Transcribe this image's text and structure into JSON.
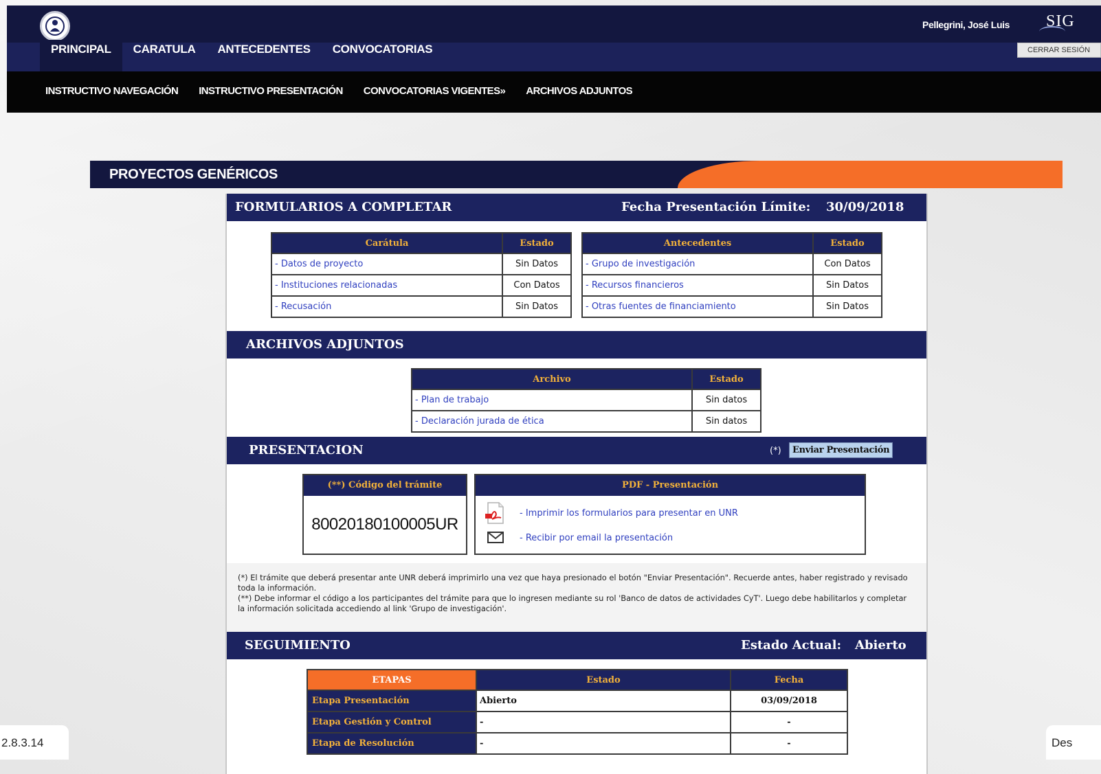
{
  "header": {
    "tabs": [
      {
        "label": "PRINCIPAL"
      },
      {
        "label": "CARATULA"
      },
      {
        "label": "ANTECEDENTES"
      },
      {
        "label": "CONVOCATORIAS"
      }
    ],
    "user_name": "Pellegrini, José Luis",
    "brand": "SIG",
    "logout_label": "CERRAR SESIÓN"
  },
  "subnav": {
    "items": [
      {
        "label": "INSTRUCTIVO NAVEGACIÓN"
      },
      {
        "label": "INSTRUCTIVO PRESENTACIÓN"
      },
      {
        "label": "CONVOCATORIAS VIGENTES»"
      },
      {
        "label": "ARCHIVOS ADJUNTOS"
      }
    ]
  },
  "page": {
    "title": "PROYECTOS GENÉRICOS"
  },
  "formularios": {
    "title": "FORMULARIOS A COMPLETAR",
    "deadline_label": "Fecha Presentación Límite:",
    "deadline_value": "30/09/2018",
    "caratula": {
      "headers": [
        "Carátula",
        "Estado"
      ],
      "rows": [
        {
          "label": "- Datos de proyecto",
          "status": "Sin Datos"
        },
        {
          "label": "- Instituciones relacionadas",
          "status": "Con Datos"
        },
        {
          "label": "- Recusación",
          "status": "Sin Datos"
        }
      ]
    },
    "antecedentes": {
      "headers": [
        "Antecedentes",
        "Estado"
      ],
      "rows": [
        {
          "label": "- Grupo de investigación",
          "status": "Con Datos"
        },
        {
          "label": "- Recursos financieros",
          "status": "Sin Datos"
        },
        {
          "label": "- Otras fuentes de financiamiento",
          "status": "Sin Datos"
        }
      ]
    }
  },
  "archivos": {
    "title": "ARCHIVOS ADJUNTOS",
    "headers": [
      "Archivo",
      "Estado"
    ],
    "rows": [
      {
        "label": "- Plan de trabajo",
        "status": "Sin datos"
      },
      {
        "label": "- Declaración jurada de ética",
        "status": "Sin datos"
      }
    ]
  },
  "presentacion": {
    "title": "PRESENTACION",
    "send_prefix": "(*)",
    "send_label": "Enviar Presentación",
    "codigo_header": "(**) Código del trámite",
    "codigo_value": "80020180100005UR",
    "pdf_header": "PDF - Presentación",
    "pdf_links": [
      {
        "label": "- Imprimir los formularios para presentar en UNR",
        "icon": "pdf-icon"
      },
      {
        "label": "- Recibir por email la presentación",
        "icon": "envelope-icon"
      }
    ],
    "notes": [
      "(*) El trámite que deberá presentar ante UNR deberá imprimirlo una vez que haya presionado el botón \"Enviar Presentación\". Recuerde antes, haber registrado y revisado toda la información.",
      "(**) Debe informar el código a los participantes del trámite para que lo ingresen mediante su rol 'Banco de datos de actividades CyT'. Luego debe habilitarlos y completar la información solicitada accediendo al link 'Grupo de investigación'."
    ]
  },
  "seguimiento": {
    "title": "SEGUIMIENTO",
    "status_label": "Estado Actual:",
    "status_value": "Abierto",
    "headers": [
      "ETAPAS",
      "Estado",
      "Fecha"
    ],
    "rows": [
      {
        "etapa": "Etapa Presentación",
        "estado": "Abierto",
        "fecha": "03/09/2018"
      },
      {
        "etapa": "Etapa Gestión y Control",
        "estado": "-",
        "fecha": "-"
      },
      {
        "etapa": "Etapa de Resolución",
        "estado": "-",
        "fecha": "-"
      }
    ]
  },
  "footer": {
    "version": "2.8.3.14",
    "right_text": "Des"
  },
  "colors": {
    "navy": "#1c2360",
    "orange": "#f56e28",
    "gold": "#f2b13a",
    "link": "#2f3fbf"
  }
}
